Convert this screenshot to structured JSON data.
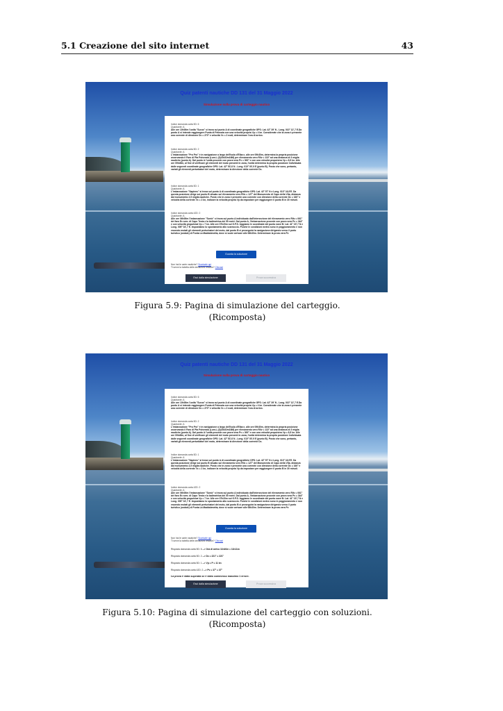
{
  "header": {
    "section": "5.1 Creazione del sito internet",
    "page_number": "43"
  },
  "quiz": {
    "title": "Quiz patenti nautiche DD 131 del 31 Maggio 2022",
    "subtitle": "Simulazione sulla prova di carteggio nautico",
    "questions": [
      {
        "header": "Indice domanda carta 5D: 6",
        "quadrant": "Quadrante: A",
        "body": "Alle ore 10h00m l'unità \"Surus\" si trova sul punto A di coordinate geografiche GPS: Lat. 42° 39' N - Long. 010° 12',7 E.Da punto A si intende raggiungere Punta di Fetovaia con una velocità propria Vp = 4 kn. Considerate che la zona è presente una corrente di direzione Dc = 270° e velocità Vc = 2 nodi, determinare l'ora di arrivo."
      },
      {
        "header": "Indice domanda carta 5D: 2",
        "quadrant": "Quadrante: A",
        "body": "L'imbarcazione \"Pro Pro\" è in navigazione a largo dell'Isola d'Elba e, alle ore 09h30m, determina la propria posizione osservando il Faro di Pta Polveraia (Lum.L.(3)15s52m16M) per rilevamento vero Rilv = 110° ad una distanza di 3 miglia nautiche (punto A). Dal punto A l'unità procede con prora vera Pv = 300° e con una velocità propulsiva Vp = 8,5 kn. Alle ore 09h45m, al fine di verificare gli elementi del moto presenti in zona, l'unità determina la propria posizione individuata dalle seguenti coordinate geografiche GPS: Lat. 42° 53',6 N - Long. 010° 00',9 E (punto B). Posto che sono, pertanto, variati gli elementi perturbatori del moto, determinare la direzione della corrente Dc."
      },
      {
        "header": "Indice domanda carta 5D: 1",
        "quadrant": "Quadrante: A",
        "body": "L'imbarcazione \"Sapiens\" si trova sul punto A di coordinate geografiche GPS: Lat. 42° 57' N e Long. 010° 16,9'E. Da questa posizione dirige sul punto B situato sul rilevamento vero Rilv = 127° del Monumento di Capo della Vita, distanza dal monumento 2,5 miglia nautiche. Posto che in zona è presente una corrente con direzione della corrente Dc = 160° e velocità della corrente Vc = 2 kn, indicare la velocità propria Vp da impostare per raggiungere il punto B in 30 minuti."
      },
      {
        "header": "Indice domanda carta 42D: 2",
        "quadrant": "Quadrante: A",
        "body": "Alle ore 06h00m l'imbarcazione \"Sonic\" si trova sul punto A individuato dall'intersezione del rilevamento vero Rilv = 061° del faro Ex sem. di Capo Testa e la batimetrica dei 50 metri. Dal punto A, l'imbarcazione procede con prora vera Pv = 344° e con velocità propulsiva Vp = 7 kn. Alle ore 07h20m sul G.P.S. leggiamo le coordinate del punto nave B: Lat. 41° 19',7 N e Long. 009° 04',7 E. Impostiamo lo spostamento allo scarroccio. Poiché le condizioni meteo sono in peggioramento e non essendo mutati gli elementi perturbatori del moto, dal punto B ci proseguirà la navigazione dirigendo verso il porto turistico (ondale) di Punta La Maddalenetta, dove si vuole arrivare alle 08h30m. Determinare la prora vera Pv"
      }
    ],
    "solve_button": "Guarda la soluzione",
    "help_note": {
      "line1_prefix": "Non hai le carte nautiche?",
      "line1_link": "Scaricale qui",
      "line2_prefix": "Ti serve la tabella delle deviazioni residue?",
      "line2_link": "Cliccaci"
    },
    "answers": [
      {
        "label": "Risposta domanda carta 5D: 6",
        "value": "--> Ora di arrivo 11h40m = 11h11m"
      },
      {
        "label": "Risposta domanda carta 5D: 2",
        "value": "--> Dc = 221° = 221°"
      },
      {
        "label": "Risposta domanda carta 5D: 1",
        "value": "--> Vp = P = 11 kn"
      },
      {
        "label": "Risposta domanda carta 42D: 2",
        "value": "--> Pv = 37° = 37°"
      }
    ],
    "verdict": "La prova è stata superata se è stato commesso massimo 1 errore.",
    "exit_button": "Esci dalla simulazione",
    "next_button": "Prova successiva"
  },
  "captions": {
    "figure_1": {
      "line1": "Figura 5.9: Pagina di simulazione del carteggio.",
      "line2": "(Ricomposta)"
    },
    "figure_2": {
      "line1": "Figura 5.10: Pagina di simulazione del carteggio con soluzioni.",
      "line2": "(Ricomposta)"
    }
  }
}
